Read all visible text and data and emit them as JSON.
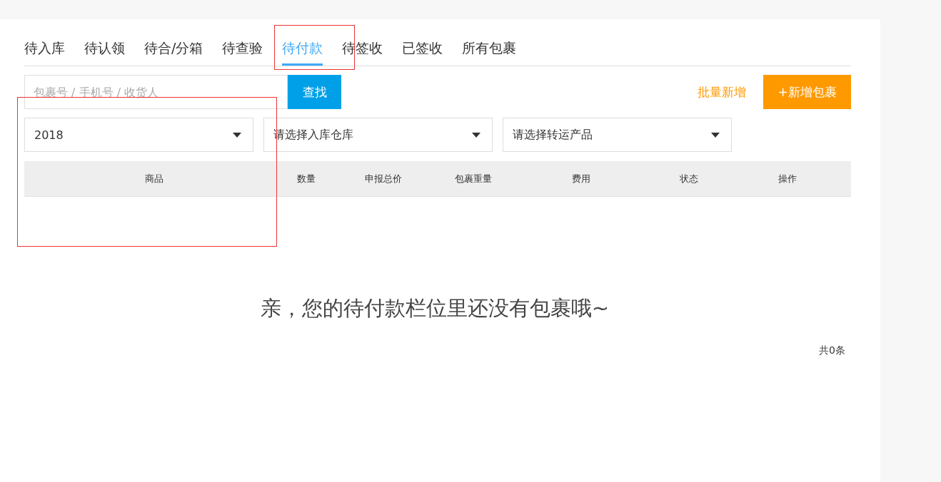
{
  "tabs": [
    {
      "label": "待入库",
      "selected": false
    },
    {
      "label": "待认领",
      "selected": false
    },
    {
      "label": "待合/分箱",
      "selected": false
    },
    {
      "label": "待查验",
      "selected": false
    },
    {
      "label": "待付款",
      "selected": true
    },
    {
      "label": "待签收",
      "selected": false
    },
    {
      "label": "已签收",
      "selected": false
    },
    {
      "label": "所有包裹",
      "selected": false
    }
  ],
  "search": {
    "placeholder": "包裹号 / 手机号 / 收货人",
    "button": "查找"
  },
  "actions": {
    "batch_add": "批量新增",
    "add_parcel": "+新增包裹"
  },
  "filters": [
    {
      "value": "2018"
    },
    {
      "value": "请选择入库仓库"
    },
    {
      "value": "请选择转运产品"
    }
  ],
  "table": {
    "columns": [
      "商品",
      "数量",
      "申报总价",
      "包裹重量",
      "费用",
      "状态",
      "操作"
    ]
  },
  "empty_message": "亲，您的待付款栏位里还没有包裹哦~",
  "total": "共0条"
}
